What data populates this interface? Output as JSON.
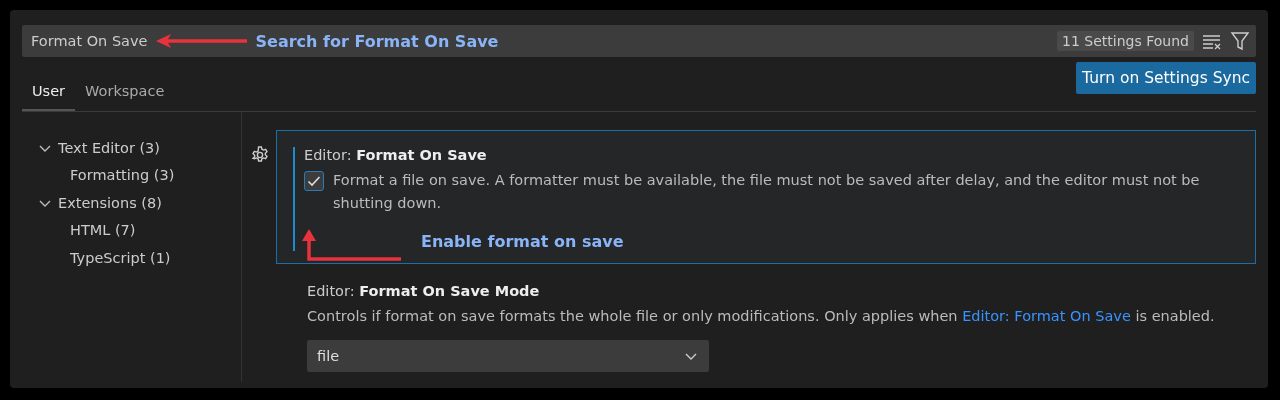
{
  "search": {
    "value": "Format On Save",
    "annotation": "Search for Format On Save",
    "result_count": "11 Settings Found"
  },
  "tabs": [
    {
      "label": "User",
      "selected": true
    },
    {
      "label": "Workspace",
      "selected": false
    }
  ],
  "sync_button": "Turn on Settings Sync",
  "tree": [
    {
      "label": "Text Editor (3)",
      "expanded": true,
      "children": [
        {
          "label": "Formatting (3)"
        }
      ]
    },
    {
      "label": "Extensions (8)",
      "expanded": true,
      "children": [
        {
          "label": "HTML (7)"
        },
        {
          "label": "TypeScript (1)"
        }
      ]
    }
  ],
  "settings": [
    {
      "kind": "checkbox",
      "title": "Editor: **Format On Save**",
      "focused": true,
      "checked": true,
      "description": "Format a file on save. A formatter must be available, the file must not be saved after delay, and the editor must not be shutting down.",
      "annotation": "Enable format on save"
    },
    {
      "kind": "select",
      "title": "Editor: **Format On Save Mode**",
      "focused": false,
      "description": "Controls if format on save formats the whole file or only modifications. Only applies when",
      "link": "Editor: Format On Save",
      "description_end": "is enabled.",
      "value": "file"
    }
  ]
}
